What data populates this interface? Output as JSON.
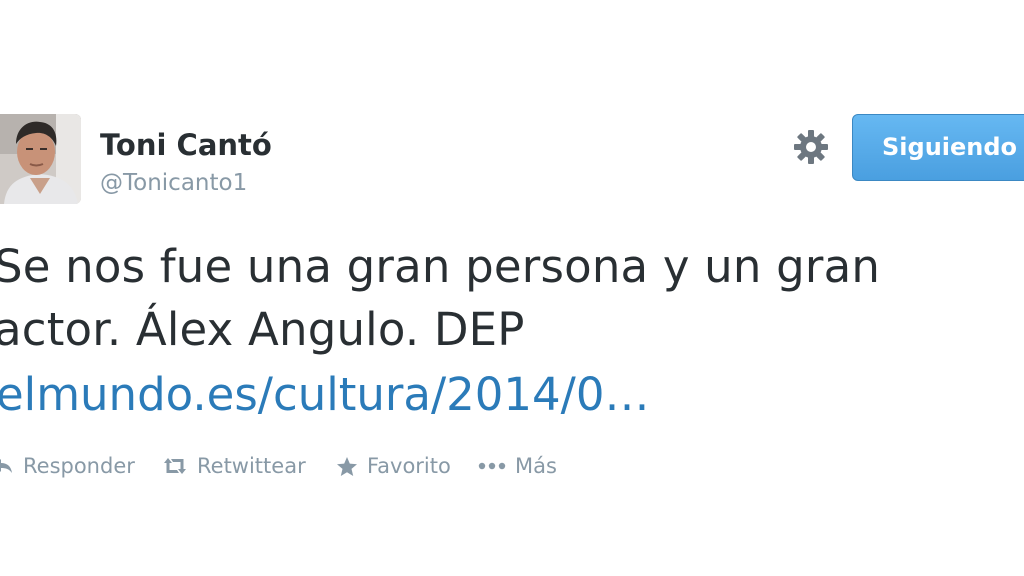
{
  "tweet": {
    "author_name": "Toni Cantó",
    "author_handle": "@Tonicanto1",
    "text_line1": "Se nos fue una gran persona y un gran",
    "text_line2": "actor. Álex Angulo. DEP",
    "link": "elmundo.es/cultura/2014/0…"
  },
  "header": {
    "follow_button_label": "Siguiendo",
    "settings_icon": "gear-icon"
  },
  "actions": {
    "reply_label": "Responder",
    "retweet_label": "Retwittear",
    "favorite_label": "Favorito",
    "more_label": "Más"
  },
  "colors": {
    "name": "#292f33",
    "muted": "#8899a6",
    "link": "#2b7bb9",
    "follow_button": "#55acee"
  }
}
